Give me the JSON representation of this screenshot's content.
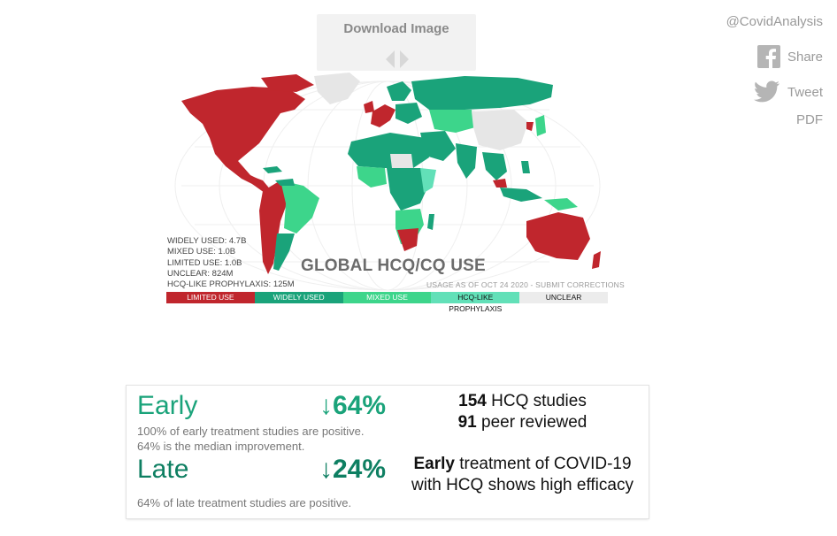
{
  "download": {
    "label": "Download Image"
  },
  "social": {
    "handle": "@CovidAnalysis",
    "share_label": "Share",
    "tweet_label": "Tweet",
    "pdf_label": "PDF"
  },
  "map": {
    "title": "GLOBAL HCQ/CQ USE",
    "usage_note": "USAGE AS OF OCT 24 2020 - SUBMIT CORRECTIONS",
    "stats": [
      "WIDELY USED: 4.7B",
      "MIXED USE: 1.0B",
      "LIMITED USE: 1.0B",
      "UNCLEAR: 824M",
      "HCQ-LIKE PROPHYLAXIS: 125M"
    ],
    "legend": [
      {
        "label": "LIMITED USE",
        "color": "#c0262d",
        "text_color": "#ffffff"
      },
      {
        "label": "WIDELY USED",
        "color": "#1aa37a",
        "text_color": "#ffffff"
      },
      {
        "label": "MIXED USE",
        "color": "#3dd58b",
        "text_color": "#ffffff"
      },
      {
        "label": "HCQ-LIKE PROPHYLAXIS",
        "color": "#62e0b8",
        "text_color": "#111111"
      },
      {
        "label": "UNCLEAR",
        "color": "#ececec",
        "text_color": "#111111"
      }
    ],
    "colors": {
      "limited": "#c0262d",
      "widely": "#1aa37a",
      "mixed": "#3dd58b",
      "prophylaxis": "#62e0b8",
      "unclear": "#e6e6e6"
    }
  },
  "results": {
    "early": {
      "label": "Early",
      "value": "↓64%",
      "desc1": "100% of early treatment studies are positive.",
      "desc2": "64% is the median improvement."
    },
    "late": {
      "label": "Late",
      "value": "↓24%",
      "desc": "64% of late treatment studies are positive."
    },
    "studies": {
      "count": "154",
      "count_suffix": " HCQ studies",
      "peer": "91",
      "peer_suffix": " peer reviewed"
    },
    "conclusion": {
      "bold": "Early",
      "rest": " treatment of COVID-19 with HCQ shows high efficacy"
    }
  }
}
